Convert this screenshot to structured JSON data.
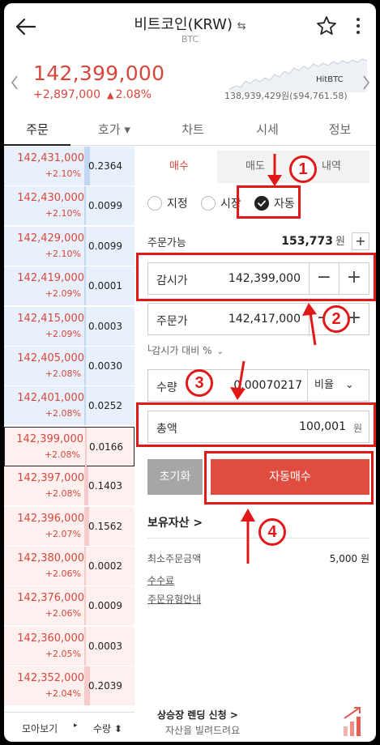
{
  "header": {
    "title": "비트코인(KRW)",
    "swap_glyph": "⇆",
    "subtitle": "BTC"
  },
  "price": {
    "current": "142,399,000",
    "change_amount": "+2,897,000",
    "change_arrow": "▲",
    "change_percent": "2.08%",
    "exchange_label": "HitBTC",
    "exchange_value": "138,939,429원($94,761.58)",
    "accent_color": "#d8473b"
  },
  "tabs": [
    "주문",
    "호가 ▾",
    "차트",
    "시세",
    "정보"
  ],
  "orderbook": {
    "asks": [
      {
        "price": "142,431,000",
        "pct": "+2.10%",
        "qty": "0.2364",
        "fill": 0.12
      },
      {
        "price": "142,430,000",
        "pct": "+2.10%",
        "qty": "0.0099",
        "fill": 0.02
      },
      {
        "price": "142,429,000",
        "pct": "+2.10%",
        "qty": "0.0099",
        "fill": 0.02
      },
      {
        "price": "142,419,000",
        "pct": "+2.09%",
        "qty": "0.0001",
        "fill": 0.01
      },
      {
        "price": "142,415,000",
        "pct": "+2.09%",
        "qty": "0.0003",
        "fill": 0.01
      },
      {
        "price": "142,405,000",
        "pct": "+2.08%",
        "qty": "0.0030",
        "fill": 0.01
      },
      {
        "price": "142,401,000",
        "pct": "+2.08%",
        "qty": "0.0252",
        "fill": 0.03
      }
    ],
    "bids": [
      {
        "price": "142,399,000",
        "pct": "+2.08%",
        "qty": "0.0166",
        "fill": 0.02
      },
      {
        "price": "142,397,000",
        "pct": "+2.08%",
        "qty": "0.1403",
        "fill": 0.08
      },
      {
        "price": "142,396,000",
        "pct": "+2.07%",
        "qty": "0.1562",
        "fill": 0.09
      },
      {
        "price": "142,380,000",
        "pct": "+2.06%",
        "qty": "0.0002",
        "fill": 0.01
      },
      {
        "price": "142,376,000",
        "pct": "+2.06%",
        "qty": "0.0009",
        "fill": 0.01
      },
      {
        "price": "142,360,000",
        "pct": "+2.05%",
        "qty": "0.0003",
        "fill": 0.01
      },
      {
        "price": "142,352,000",
        "pct": "+2.04%",
        "qty": "0.2039",
        "fill": 0.12
      }
    ],
    "footer_left": "모아보기",
    "footer_arrow": "▸",
    "footer_right": "수량 ⬍"
  },
  "order": {
    "subtabs": [
      "매수",
      "매도",
      "내역"
    ],
    "types": [
      "지정",
      "시장",
      "자동"
    ],
    "available_label": "주문가능",
    "available_value": "153,773",
    "won": "원",
    "plus": "+",
    "watch_price_label": "감시가",
    "watch_price_value": "142,399,000",
    "order_price_label": "주문가",
    "order_price_value": "142,417,000",
    "minus": "−",
    "ratio_label": "감시가 대비 %",
    "ratio_prefix": "└",
    "chevron": "⌄",
    "qty_label": "수량",
    "qty_value": "0.00070217",
    "qty_select": "비율",
    "total_label": "총액",
    "total_value": "100,001",
    "reset_label": "초기화",
    "submit_label": "자동매수",
    "holdings_label": "보유자산 >",
    "min_order_label": "최소주문금액",
    "min_order_value": "5,000 원",
    "fee_label": "수수료",
    "order_type_guide": "주문유형안내",
    "banner_title": "상승장 렌딩 신청 >",
    "banner_sub": "자산을 빌려드려요"
  },
  "annotations": [
    "1",
    "2",
    "3",
    "4"
  ],
  "annotation_color": "#e21818"
}
